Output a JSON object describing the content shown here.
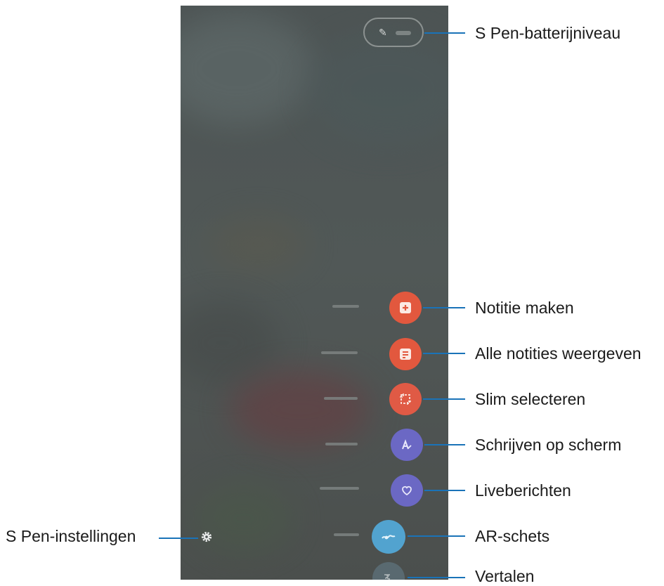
{
  "callouts": {
    "battery": "S Pen-batterijniveau",
    "create_note": "Notitie maken",
    "view_all_notes": "Alle notities weergeven",
    "smart_select": "Slim selecteren",
    "screen_write": "Schrijven op scherm",
    "live_messages": "Liveberichten",
    "ar_doodle": "AR-schets",
    "translate": "Vertalen",
    "settings": "S Pen-instellingen"
  },
  "menu": {
    "items": [
      {
        "id": "create_note",
        "icon": "note-add-icon",
        "color": "#e2583e"
      },
      {
        "id": "view_all_notes",
        "icon": "notes-list-icon",
        "color": "#e2583e"
      },
      {
        "id": "smart_select",
        "icon": "smart-select-icon",
        "color": "#e2583e"
      },
      {
        "id": "screen_write",
        "icon": "pen-write-icon",
        "color": "#6b68c4"
      },
      {
        "id": "live_messages",
        "icon": "live-message-icon",
        "color": "#6b68c4"
      },
      {
        "id": "ar_doodle",
        "icon": "ar-doodle-icon",
        "color": "#4f9fcc"
      },
      {
        "id": "translate",
        "icon": "translate-icon",
        "color": "#5a6f7a"
      }
    ]
  },
  "colors": {
    "callout_line": "#1a73b8",
    "screen_background": "#4f5555"
  }
}
